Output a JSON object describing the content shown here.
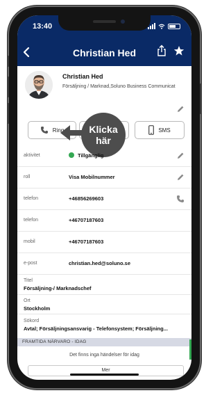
{
  "status": {
    "time": "13:40"
  },
  "nav": {
    "title": "Christian Hed",
    "back_icon": "chevron-left-icon",
    "share_icon": "share-icon",
    "star_icon": "star-icon"
  },
  "contact": {
    "name": "Christian Hed",
    "subtitle": "Försäljning / Marknad,Soluno Business Communicat"
  },
  "actions": {
    "call_label": "Ring",
    "sms_label": "SMS",
    "overlay_line1": "Klicka",
    "overlay_line2": "här"
  },
  "rows": [
    {
      "label": "aktivitet",
      "value": "Tillgänglig",
      "status_color": "#34a853"
    },
    {
      "label": "roll",
      "value": "Visa Mobilnummer"
    },
    {
      "label": "telefon",
      "value": "+46856269603"
    },
    {
      "label": "telefon",
      "value": "+46707187603"
    },
    {
      "label": "mobil",
      "value": "+46707187603"
    },
    {
      "label": "e-post",
      "value": "christian.hed@soluno.se"
    }
  ],
  "details": [
    {
      "label": "Titel",
      "value": "Försäljning-/ Marknadschef"
    },
    {
      "label": "Ort",
      "value": "Stockholm"
    },
    {
      "label": "Sökord",
      "value": "Avtal; Försäljningsansvarig - Telefonsystem; Försäljning..."
    }
  ],
  "presence": {
    "section_title": "FRAMTIDA NÄRVARO - IDAG",
    "empty_text": "Det finns inga händelser för idag",
    "more_label": "Mer"
  },
  "colors": {
    "header": "#0a2a66",
    "available": "#34a853"
  }
}
